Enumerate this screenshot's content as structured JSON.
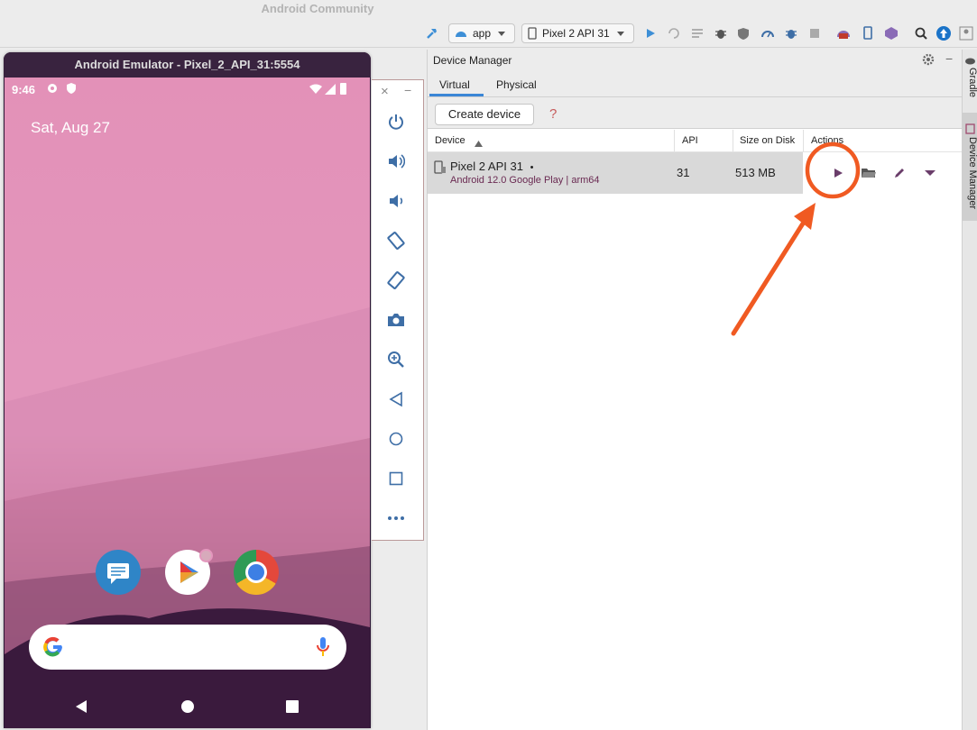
{
  "window": {
    "title": "Android Community"
  },
  "toolbar": {
    "run_config": "app",
    "device_selector": "Pixel 2 API 31",
    "icons": [
      "hammer-icon",
      "run-icon",
      "apply-changes-icon",
      "debug-icon",
      "profile-icon",
      "stop-icon",
      "sdk-manager-icon",
      "search-icon",
      "update-icon"
    ]
  },
  "emulator": {
    "title": "Android Emulator - Pixel_2_API_31:5554",
    "status_bar": {
      "time": "9:46"
    },
    "home": {
      "date": "Sat, Aug 27"
    },
    "dock_apps": [
      "messages-app-icon",
      "play-store-app-icon",
      "chrome-app-icon"
    ],
    "controls": [
      "power-icon",
      "volume-up-icon",
      "volume-down-icon",
      "rotate-left-icon",
      "rotate-right-icon",
      "camera-icon",
      "zoom-icon",
      "back-icon",
      "home-icon",
      "overview-icon",
      "more-icon"
    ],
    "panel_buttons": {
      "close": "×",
      "minimize": "−"
    }
  },
  "device_manager": {
    "title": "Device Manager",
    "tabs": [
      {
        "label": "Virtual",
        "selected": true
      },
      {
        "label": "Physical",
        "selected": false
      }
    ],
    "create_button": "Create device",
    "help": "?",
    "columns": {
      "device": "Device",
      "api": "API",
      "size": "Size on Disk",
      "actions": "Actions"
    },
    "devices": [
      {
        "name": "Pixel 2 API 31",
        "marker": "•",
        "subtitle": "Android 12.0 Google Play | arm64",
        "api": "31",
        "size": "513 MB"
      }
    ]
  },
  "side_tabs": {
    "gradle": "Gradle",
    "device_manager": "Device Manager"
  },
  "annotation": {
    "color": "#f05a22",
    "target": "launch-button"
  }
}
